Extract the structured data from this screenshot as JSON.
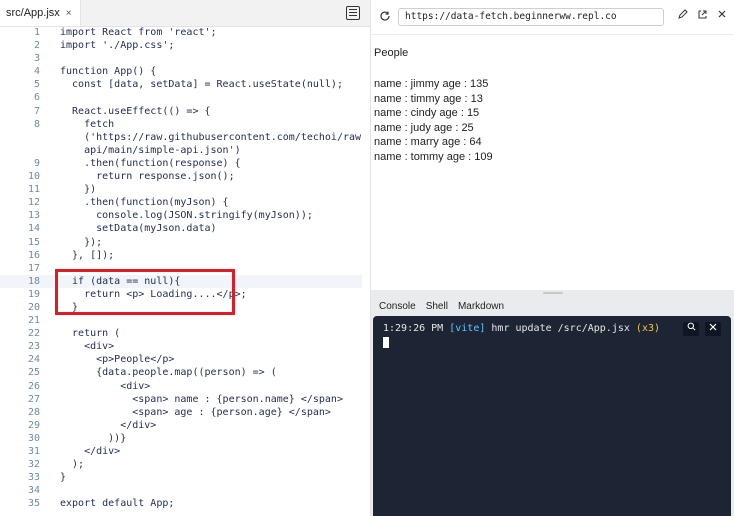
{
  "editor": {
    "tab_label": "src/App.jsx",
    "tab_close": "×",
    "lines": [
      {
        "n": "1",
        "t": "import React from 'react';"
      },
      {
        "n": "2",
        "t": "import './App.css';"
      },
      {
        "n": "3",
        "t": ""
      },
      {
        "n": "4",
        "t": "function App() {"
      },
      {
        "n": "5",
        "t": "  const [data, setData] = React.useState(null);"
      },
      {
        "n": "6",
        "t": ""
      },
      {
        "n": "7",
        "t": "  React.useEffect(() => {"
      },
      {
        "n": "8",
        "t": "    fetch"
      },
      {
        "n": "",
        "t": "    ('https://raw.githubusercontent.com/techoi/raw-data-"
      },
      {
        "n": "",
        "t": "    api/main/simple-api.json')"
      },
      {
        "n": "9",
        "t": "    .then(function(response) {"
      },
      {
        "n": "10",
        "t": "      return response.json();"
      },
      {
        "n": "11",
        "t": "    })"
      },
      {
        "n": "12",
        "t": "    .then(function(myJson) {"
      },
      {
        "n": "13",
        "t": "      console.log(JSON.stringify(myJson));"
      },
      {
        "n": "14",
        "t": "      setData(myJson.data)"
      },
      {
        "n": "15",
        "t": "    });"
      },
      {
        "n": "16",
        "t": "  }, []);"
      },
      {
        "n": "17",
        "t": ""
      },
      {
        "n": "18",
        "t": "  if (data == null){"
      },
      {
        "n": "19",
        "t": "    return <p> Loading....</p>;"
      },
      {
        "n": "20",
        "t": "  }"
      },
      {
        "n": "21",
        "t": ""
      },
      {
        "n": "22",
        "t": "  return ("
      },
      {
        "n": "23",
        "t": "    <div>"
      },
      {
        "n": "24",
        "t": "      <p>People</p>"
      },
      {
        "n": "25",
        "t": "      {data.people.map((person) => ("
      },
      {
        "n": "26",
        "t": "          <div>"
      },
      {
        "n": "27",
        "t": "            <span> name : {person.name} </span>"
      },
      {
        "n": "28",
        "t": "            <span> age : {person.age} </span>"
      },
      {
        "n": "29",
        "t": "          </div>"
      },
      {
        "n": "30",
        "t": "        ))}"
      },
      {
        "n": "31",
        "t": "    </div>"
      },
      {
        "n": "32",
        "t": "  );"
      },
      {
        "n": "33",
        "t": "}"
      },
      {
        "n": "34",
        "t": ""
      },
      {
        "n": "35",
        "t": "export default App;"
      }
    ]
  },
  "browser": {
    "url": "https://data-fetch.beginnerww.repl.co",
    "heading": "People",
    "people": [
      "name : jimmy age : 135",
      "name : timmy age : 13",
      "name : cindy age : 15",
      "name : judy age : 25",
      "name : marry age : 64",
      "name : tommy age : 109"
    ]
  },
  "console": {
    "tabs": [
      "Console",
      "Shell",
      "Markdown"
    ],
    "time": "1:29:26 PM",
    "vite": "[vite]",
    "msg": "hmr update /src/App.jsx",
    "count": "(x3)"
  },
  "icons": {
    "reload": "reload-icon",
    "edit": "pencil-icon",
    "external": "open-external-icon",
    "close": "close-icon",
    "search": "search-icon"
  }
}
